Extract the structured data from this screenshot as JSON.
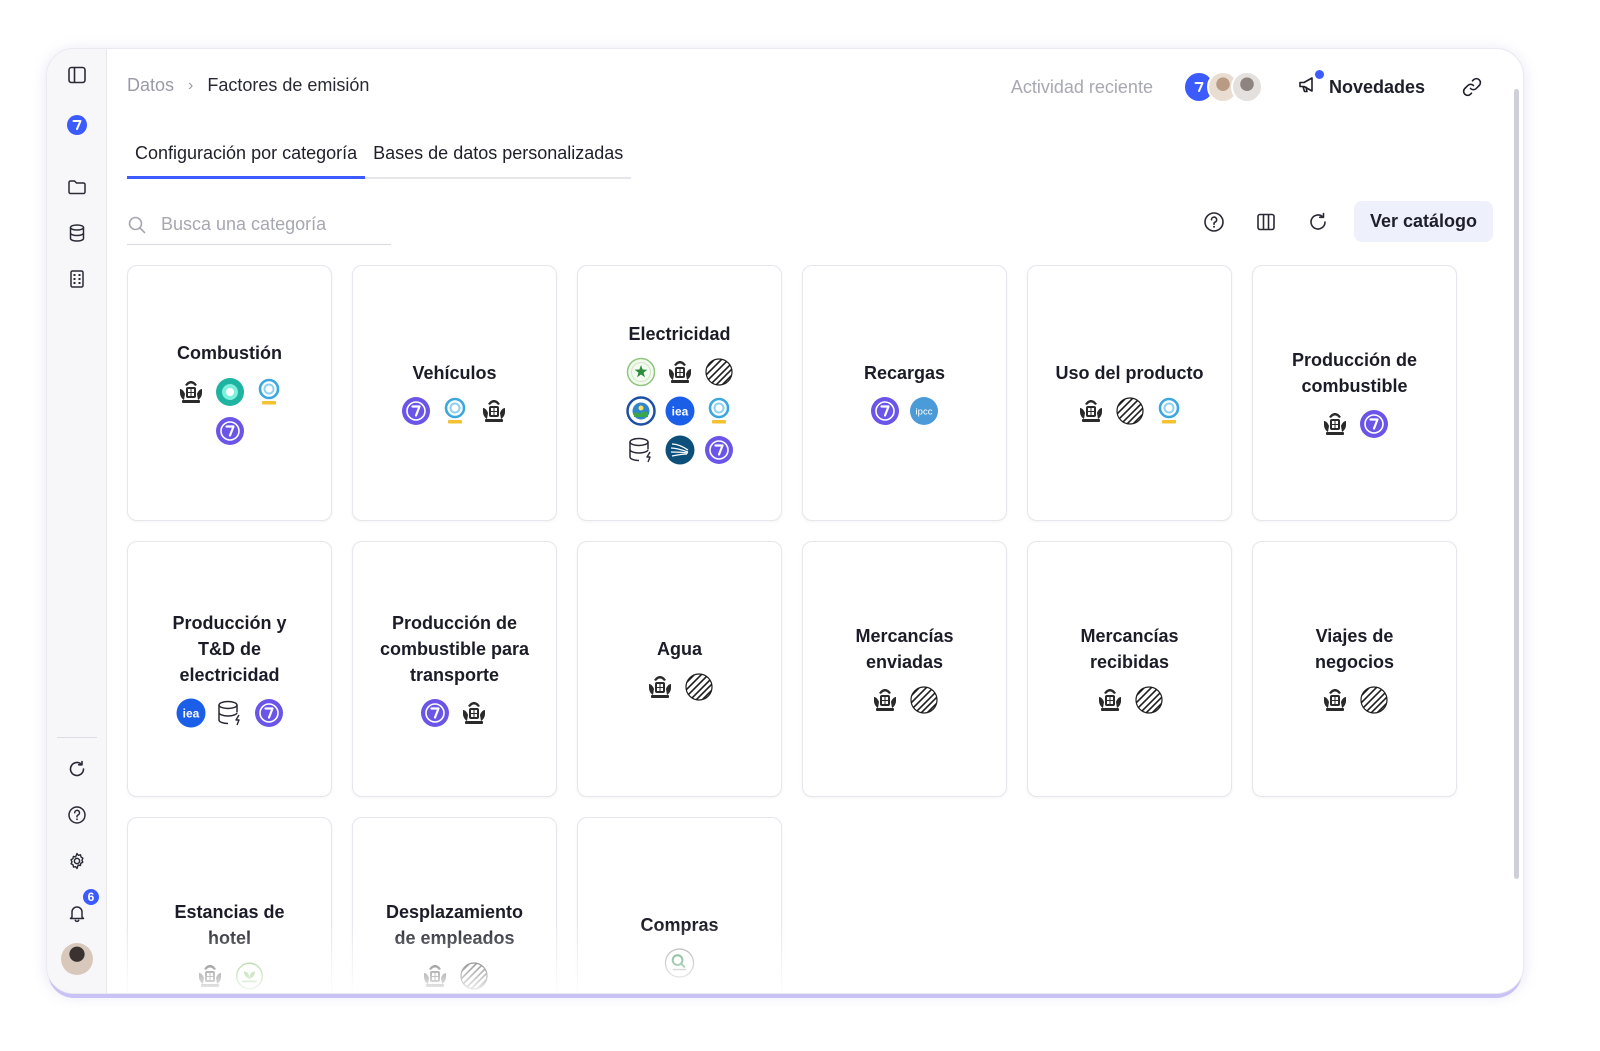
{
  "breadcrumb": {
    "parent": "Datos",
    "current": "Factores de emisión",
    "separator": "›"
  },
  "header": {
    "activity": "Actividad reciente",
    "news": "Novedades"
  },
  "tabs": [
    {
      "label": "Configuración por categoría",
      "active": true
    },
    {
      "label": "Bases de datos personalizadas",
      "active": false
    }
  ],
  "search": {
    "placeholder": "Busca una categoría"
  },
  "toolbar": {
    "catalog_button": "Ver catálogo"
  },
  "notifications": {
    "count": "6"
  },
  "colors": {
    "accent": "#3b5bff",
    "brand_purple": "#6b54e8",
    "iea_blue": "#1b5ee8"
  },
  "categories": [
    {
      "title": "Combustión",
      "logos": [
        "uk-crest",
        "teal-ring",
        "climatiq",
        "dcycle"
      ]
    },
    {
      "title": "Vehículos",
      "logos": [
        "dcycle",
        "climatiq",
        "uk-crest"
      ]
    },
    {
      "title": "Electricidad",
      "logos": [
        "green-seal",
        "uk-crest",
        "striped-globe",
        "epa-seal",
        "iea",
        "climatiq",
        "database",
        "fan-logo",
        "dcycle"
      ]
    },
    {
      "title": "Recargas",
      "logos": [
        "dcycle",
        "ipcc"
      ]
    },
    {
      "title": "Uso del producto",
      "logos": [
        "uk-crest",
        "striped-globe",
        "climatiq"
      ]
    },
    {
      "title": "Producción de combustible",
      "logos": [
        "uk-crest",
        "dcycle"
      ]
    },
    {
      "title": "Producción y T&D de electricidad",
      "logos": [
        "iea",
        "database",
        "dcycle"
      ]
    },
    {
      "title": "Producción de combustible para transporte",
      "logos": [
        "dcycle",
        "uk-crest"
      ]
    },
    {
      "title": "Agua",
      "logos": [
        "uk-crest",
        "striped-globe"
      ]
    },
    {
      "title": "Mercancías enviadas",
      "logos": [
        "uk-crest",
        "striped-globe"
      ]
    },
    {
      "title": "Mercancías recibidas",
      "logos": [
        "uk-crest",
        "striped-globe"
      ]
    },
    {
      "title": "Viajes de negocios",
      "logos": [
        "uk-crest",
        "striped-globe"
      ]
    },
    {
      "title": "Estancias de hotel",
      "logos": [
        "uk-crest",
        "greenview"
      ]
    },
    {
      "title": "Desplazamiento de empleados",
      "logos": [
        "uk-crest",
        "striped-globe"
      ]
    },
    {
      "title": "Compras",
      "logos": [
        "exiobase"
      ]
    }
  ],
  "logo_texts": {
    "iea": "iea",
    "ipcc": "ipcc"
  }
}
